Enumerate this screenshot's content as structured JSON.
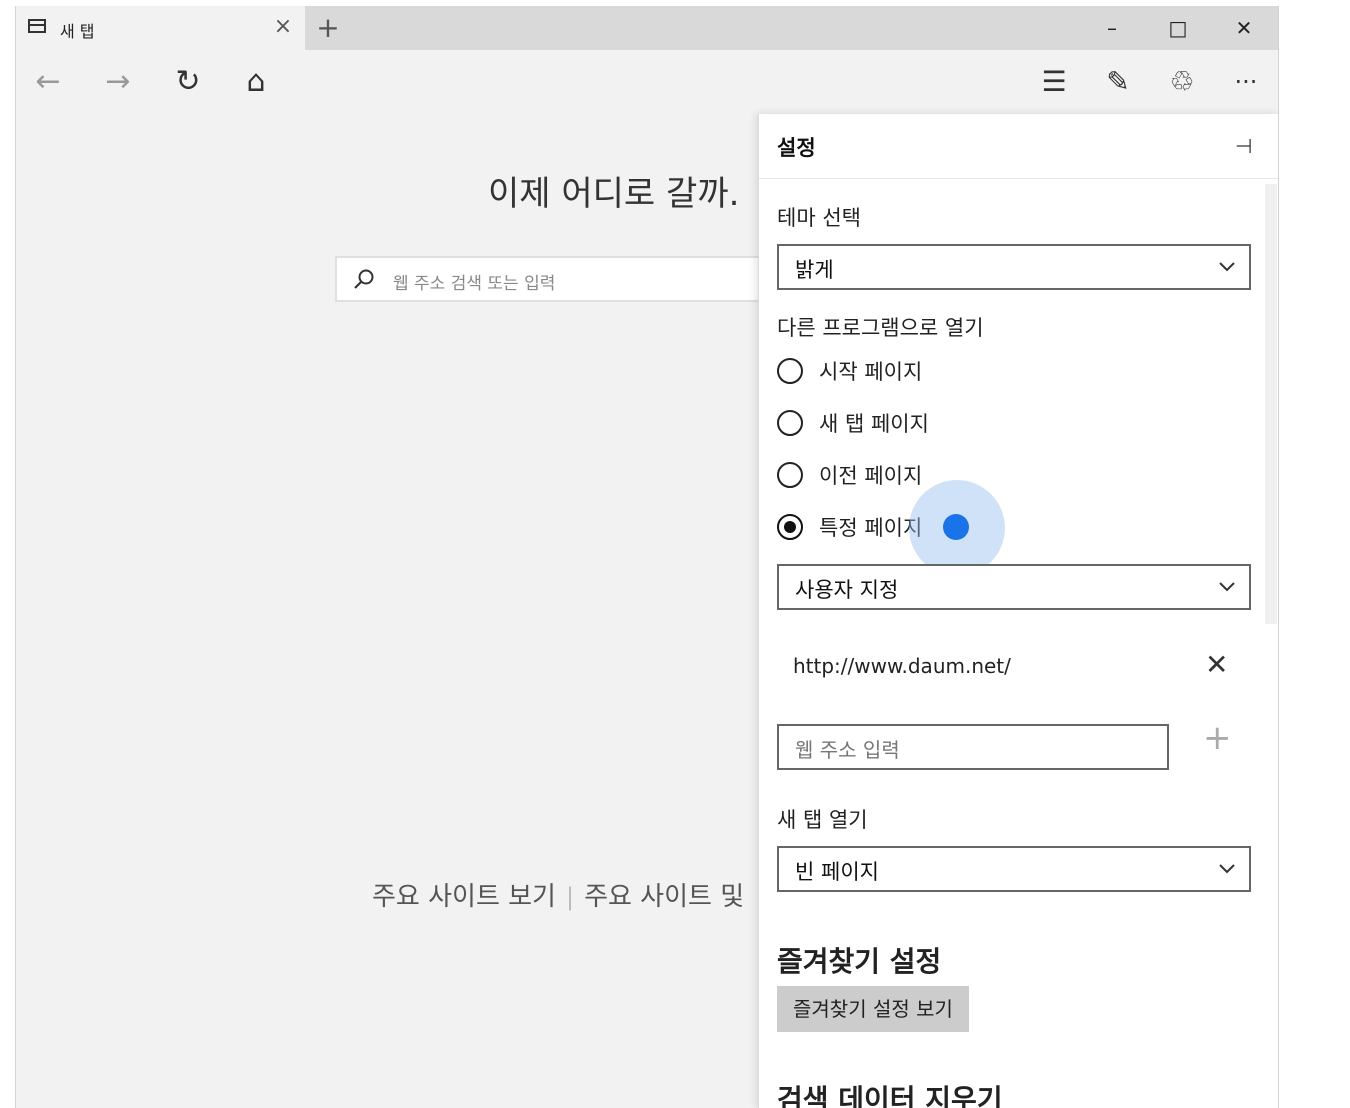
{
  "tab": {
    "title": "새 탭",
    "close_glyph": "×"
  },
  "titlebar": {
    "new_tab_glyph": "+",
    "minimize_glyph": "–",
    "maximize_glyph": "□",
    "close_glyph": "✕"
  },
  "nav": {
    "back_glyph": "←",
    "forward_glyph": "→",
    "refresh_glyph": "↻",
    "home_glyph": "⌂",
    "hub_glyph": "☰",
    "note_glyph": "✎",
    "share_glyph": "♲",
    "more_glyph": "···"
  },
  "newtab": {
    "heading": "이제 어디로 갈까.",
    "search_placeholder": "웹 주소 검색 또는 입력",
    "footer_link1": "주요 사이트 보기",
    "footer_sep": "|",
    "footer_link2": "주요 사이트 및"
  },
  "settings": {
    "title": "설정",
    "pin_glyph": "⊣",
    "theme_label": "테마 선택",
    "theme_value": "밝게",
    "open_with_label": "다른 프로그램으로 열기",
    "radio_options": [
      {
        "label": "시작 페이지",
        "selected": false
      },
      {
        "label": "새 탭 페이지",
        "selected": false
      },
      {
        "label": "이전 페이지",
        "selected": false
      },
      {
        "label": "특정 페이지",
        "selected": true
      }
    ],
    "specific_page_value": "사용자 지정",
    "url_entry": "http://www.daum.net/",
    "url_remove_glyph": "✕",
    "url_input_placeholder": "웹 주소 입력",
    "url_add_glyph": "+",
    "new_tab_open_label": "새 탭 열기",
    "new_tab_open_value": "빈 페이지",
    "favorites_heading": "즐겨찾기 설정",
    "favorites_button": "즐겨찾기 설정 보기",
    "clear_data_heading": "검색 데이터 지우기"
  },
  "colors": {
    "accent": "#1a73e8",
    "panel_bg": "#ffffff",
    "chrome_bg": "#f2f2f2",
    "titlebar_bg": "#d9d9d9"
  }
}
